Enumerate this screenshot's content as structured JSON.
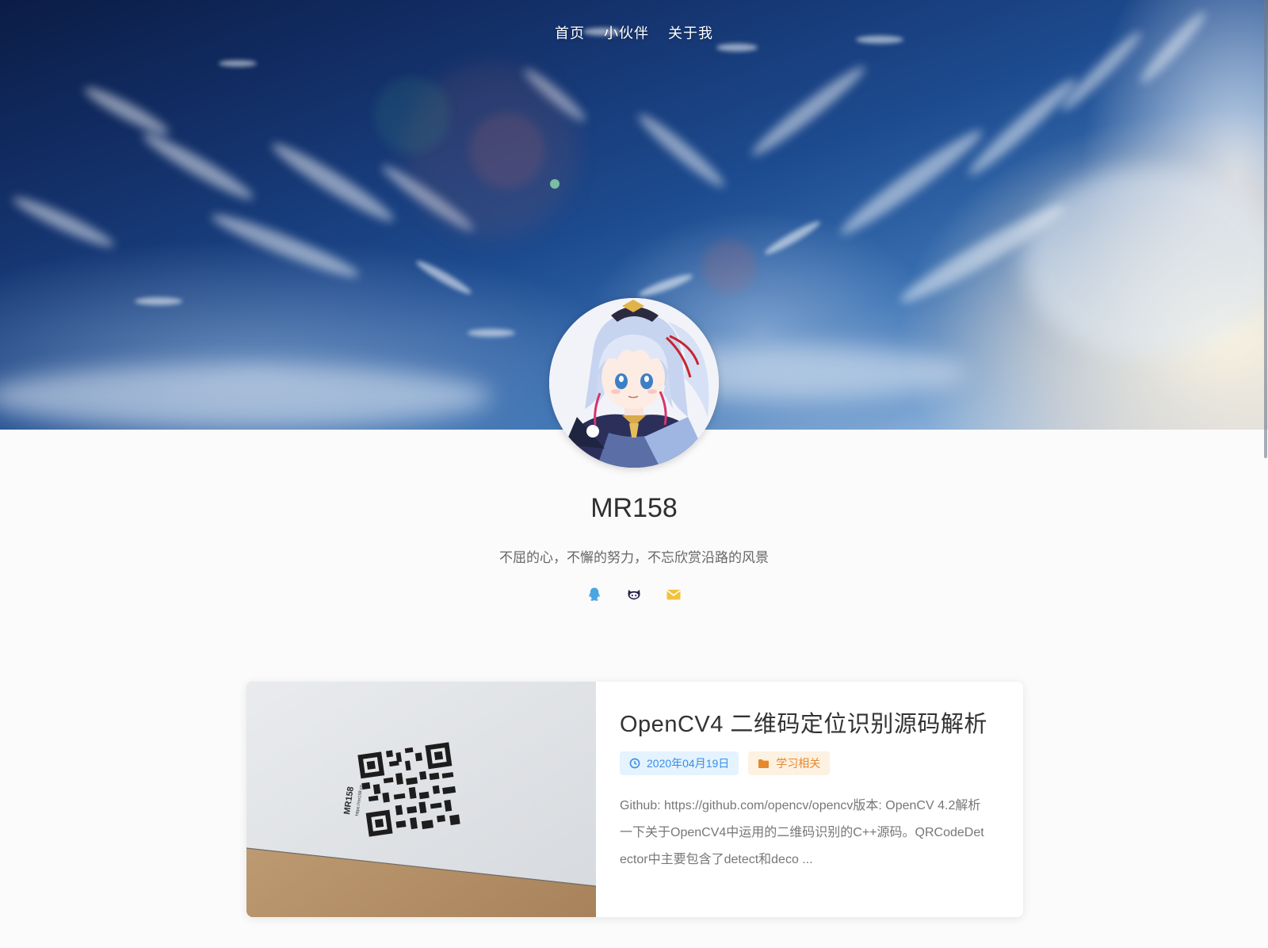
{
  "nav": {
    "items": [
      {
        "label": "首页"
      },
      {
        "label": "小伙伴"
      },
      {
        "label": "关于我"
      }
    ]
  },
  "profile": {
    "name": "MR158",
    "motto": "不屈的心，不懈的努力，不忘欣赏沿路的风景",
    "socials": [
      {
        "icon": "qq-icon",
        "color": "#4aa6e0"
      },
      {
        "icon": "github-icon",
        "color": "#24214a"
      },
      {
        "icon": "mail-icon",
        "color": "#f2c23b"
      }
    ]
  },
  "post": {
    "title": "OpenCV4 二维码定位识别源码解析",
    "date": "2020年04月19日",
    "category": "学习相关",
    "excerpt": "Github: https://github.com/opencv/opencv版本: OpenCV 4.2解析一下关于OpenCV4中运用的二维码识别的C++源码。QRCodeDetector中主要包含了detect和deco ...",
    "image": {
      "card_text": "MR158",
      "card_subtext": "https://mr158.cn"
    }
  },
  "colors": {
    "date_tag_bg": "#e4f3fe",
    "date_tag_text": "#3a8ee6",
    "category_tag_bg": "#fdf1e2",
    "category_tag_text": "#e6882d"
  }
}
